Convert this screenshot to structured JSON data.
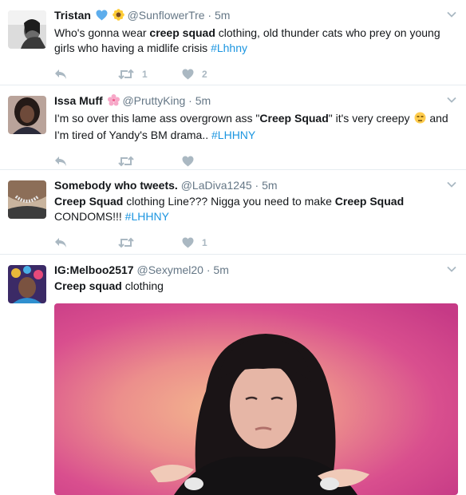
{
  "tweets": [
    {
      "name": "Tristan",
      "emoji": [
        "blue-heart",
        "sunflower"
      ],
      "handle": "@SunflowerTre",
      "sep": "·",
      "time": "5m",
      "text": [
        {
          "t": "Who's gonna wear "
        },
        {
          "t": "creep squad",
          "b": true
        },
        {
          "t": " clothing, old thunder cats who prey on young girls who having a midlife crisis  "
        },
        {
          "t": "#Lhhny",
          "h": true
        }
      ],
      "retweets": "1",
      "likes": "2"
    },
    {
      "name": "Issa Muff",
      "emoji": [
        "cherry-blossom"
      ],
      "handle": "@PruttyKing",
      "sep": "·",
      "time": "5m",
      "text": [
        {
          "t": "I'm so over this lame ass overgrown ass \""
        },
        {
          "t": "Creep Squad",
          "b": true
        },
        {
          "t": "\" it's very creepy "
        },
        {
          "e": "unamused-face"
        },
        {
          "t": " and I'm tired of Yandy's BM drama.. "
        },
        {
          "t": "#LHHNY",
          "h": true
        }
      ],
      "retweets": "",
      "likes": ""
    },
    {
      "name": "Somebody who tweets.",
      "emoji": [],
      "handle": "@LaDiva1245",
      "sep": "·",
      "time": "5m",
      "text": [
        {
          "t": "Creep Squad",
          "b": true
        },
        {
          "t": " clothing Line??? Nigga you need to make "
        },
        {
          "t": "Creep Squad",
          "b": true
        },
        {
          "t": " CONDOMS!!! "
        },
        {
          "t": "#LHHNY",
          "h": true
        }
      ],
      "retweets": "",
      "likes": "1"
    },
    {
      "name": "IG:Melboo2517",
      "emoji": [],
      "handle": "@Sexymel20",
      "sep": "·",
      "time": "5m",
      "text": [
        {
          "t": "Creep squad",
          "b": true
        },
        {
          "t": " clothing"
        }
      ]
    }
  ],
  "icons": {
    "reply": "reply-icon",
    "retweet": "retweet-icon",
    "like": "heart-icon",
    "more": "chevron-down-icon"
  },
  "colors": {
    "hashtag": "#1b95e0",
    "meta": "#657786",
    "action": "#aab8c2",
    "divider": "#e6ecf0"
  }
}
